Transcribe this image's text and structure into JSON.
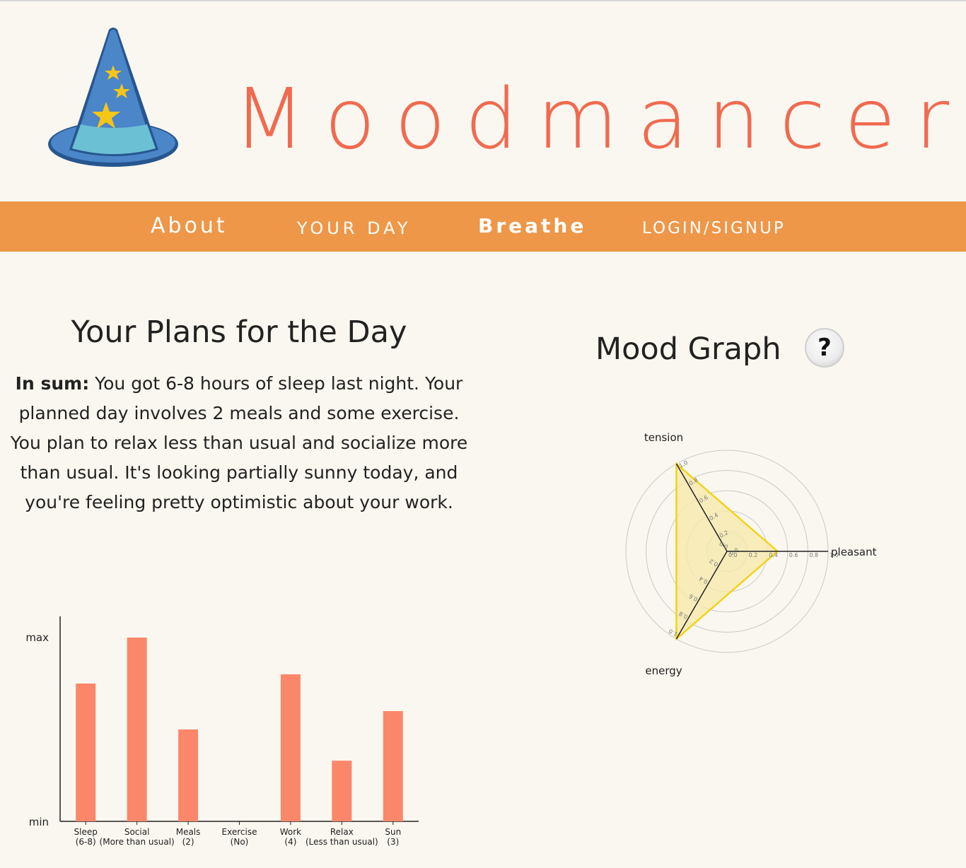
{
  "brand": {
    "title": "Moodmancer",
    "logo_icon": "wizard-hat-icon"
  },
  "nav": {
    "about": "About",
    "your_day": "YOUR DAY",
    "breathe": "Breathe",
    "login": "LOGIN/SIGNUP"
  },
  "plans": {
    "title": "Your Plans for the Day",
    "summary_lead": "In sum:",
    "summary_text": " You got 6-8 hours of sleep last night. Your planned day involves 2 meals and some exercise. You plan to relax less than usual and socialize more than usual. It's looking partially sunny today, and you're feeling pretty optimistic about your work."
  },
  "mood": {
    "title": "Mood Graph",
    "help_label": "?"
  },
  "chart_data": [
    {
      "type": "bar",
      "categories": [
        "Sleep",
        "Social",
        "Meals",
        "Exercise",
        "Work",
        "Relax",
        "Sun"
      ],
      "sublabels": [
        "(6-8)",
        "(More than usual)",
        "(2)",
        "(No)",
        "(4)",
        "(Less than usual)",
        "(3)"
      ],
      "values": [
        0.75,
        1.0,
        0.5,
        0.0,
        0.8,
        0.33,
        0.6
      ],
      "ytick_labels": [
        "min",
        "max"
      ],
      "ylim": [
        0,
        1
      ],
      "color": "#fb876a"
    },
    {
      "type": "radar",
      "axes": [
        "tension",
        "pleasant",
        "energy"
      ],
      "values": [
        1.0,
        0.5,
        1.0
      ],
      "rlim": [
        0,
        1.0
      ],
      "rticks": [
        "0.0",
        "0.2",
        "0.4",
        "0.6",
        "0.8",
        "1.0"
      ],
      "stroke_color": "#f2d31b",
      "fill_color": "#f7e9a8"
    }
  ]
}
